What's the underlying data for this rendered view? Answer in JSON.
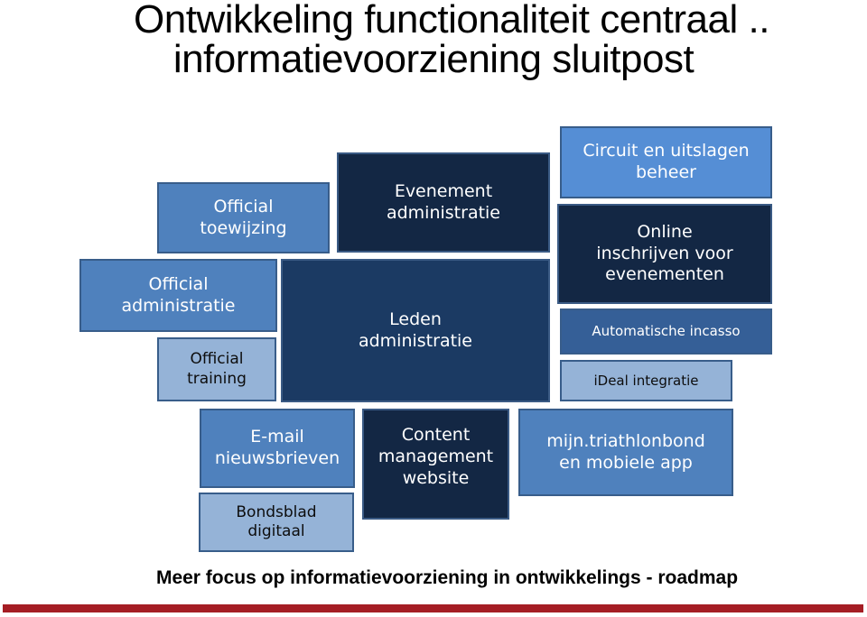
{
  "title": {
    "line1": "Ontwikkeling functionaliteit centraal ..",
    "line2": "informatievoorziening sluitpost"
  },
  "colors": {
    "medium_blue": "#4f81bd",
    "light_blue": "#95b3d7",
    "dark_navy": "#132744",
    "navy": "#1b3a63",
    "bright_blue": "#558ed5",
    "steel_blue": "#355f97",
    "accent_red": "#a51d24"
  },
  "boxes": {
    "official_toewijzing": [
      "Official",
      "toewijzing"
    ],
    "official_administratie": [
      "Official",
      "administratie"
    ],
    "official_training": [
      "Official",
      "training"
    ],
    "evenement_administratie": [
      "Evenement",
      "administratie"
    ],
    "leden_administratie": [
      "Leden",
      "administratie"
    ],
    "circuit_uitslagen": [
      "Circuit en uitslagen",
      "beheer"
    ],
    "online_inschrijven": [
      "Online",
      "inschrijven voor",
      "evenementen"
    ],
    "automatische_incasso": [
      "Automatische incasso"
    ],
    "ideal_integratie": [
      "iDeal integratie"
    ],
    "email_nieuwsbrieven": [
      "E-mail",
      "nieuwsbrieven"
    ],
    "bondsblad_digitaal": [
      "Bondsblad",
      "digitaal"
    ],
    "content_management": [
      "Content",
      "management",
      "website"
    ],
    "mijn_triathlonbond": [
      "mijn.triathlonbond",
      "en mobiele app"
    ]
  },
  "footer": {
    "text": "Meer focus op informatievoorziening in ontwikkelings - roadmap"
  }
}
